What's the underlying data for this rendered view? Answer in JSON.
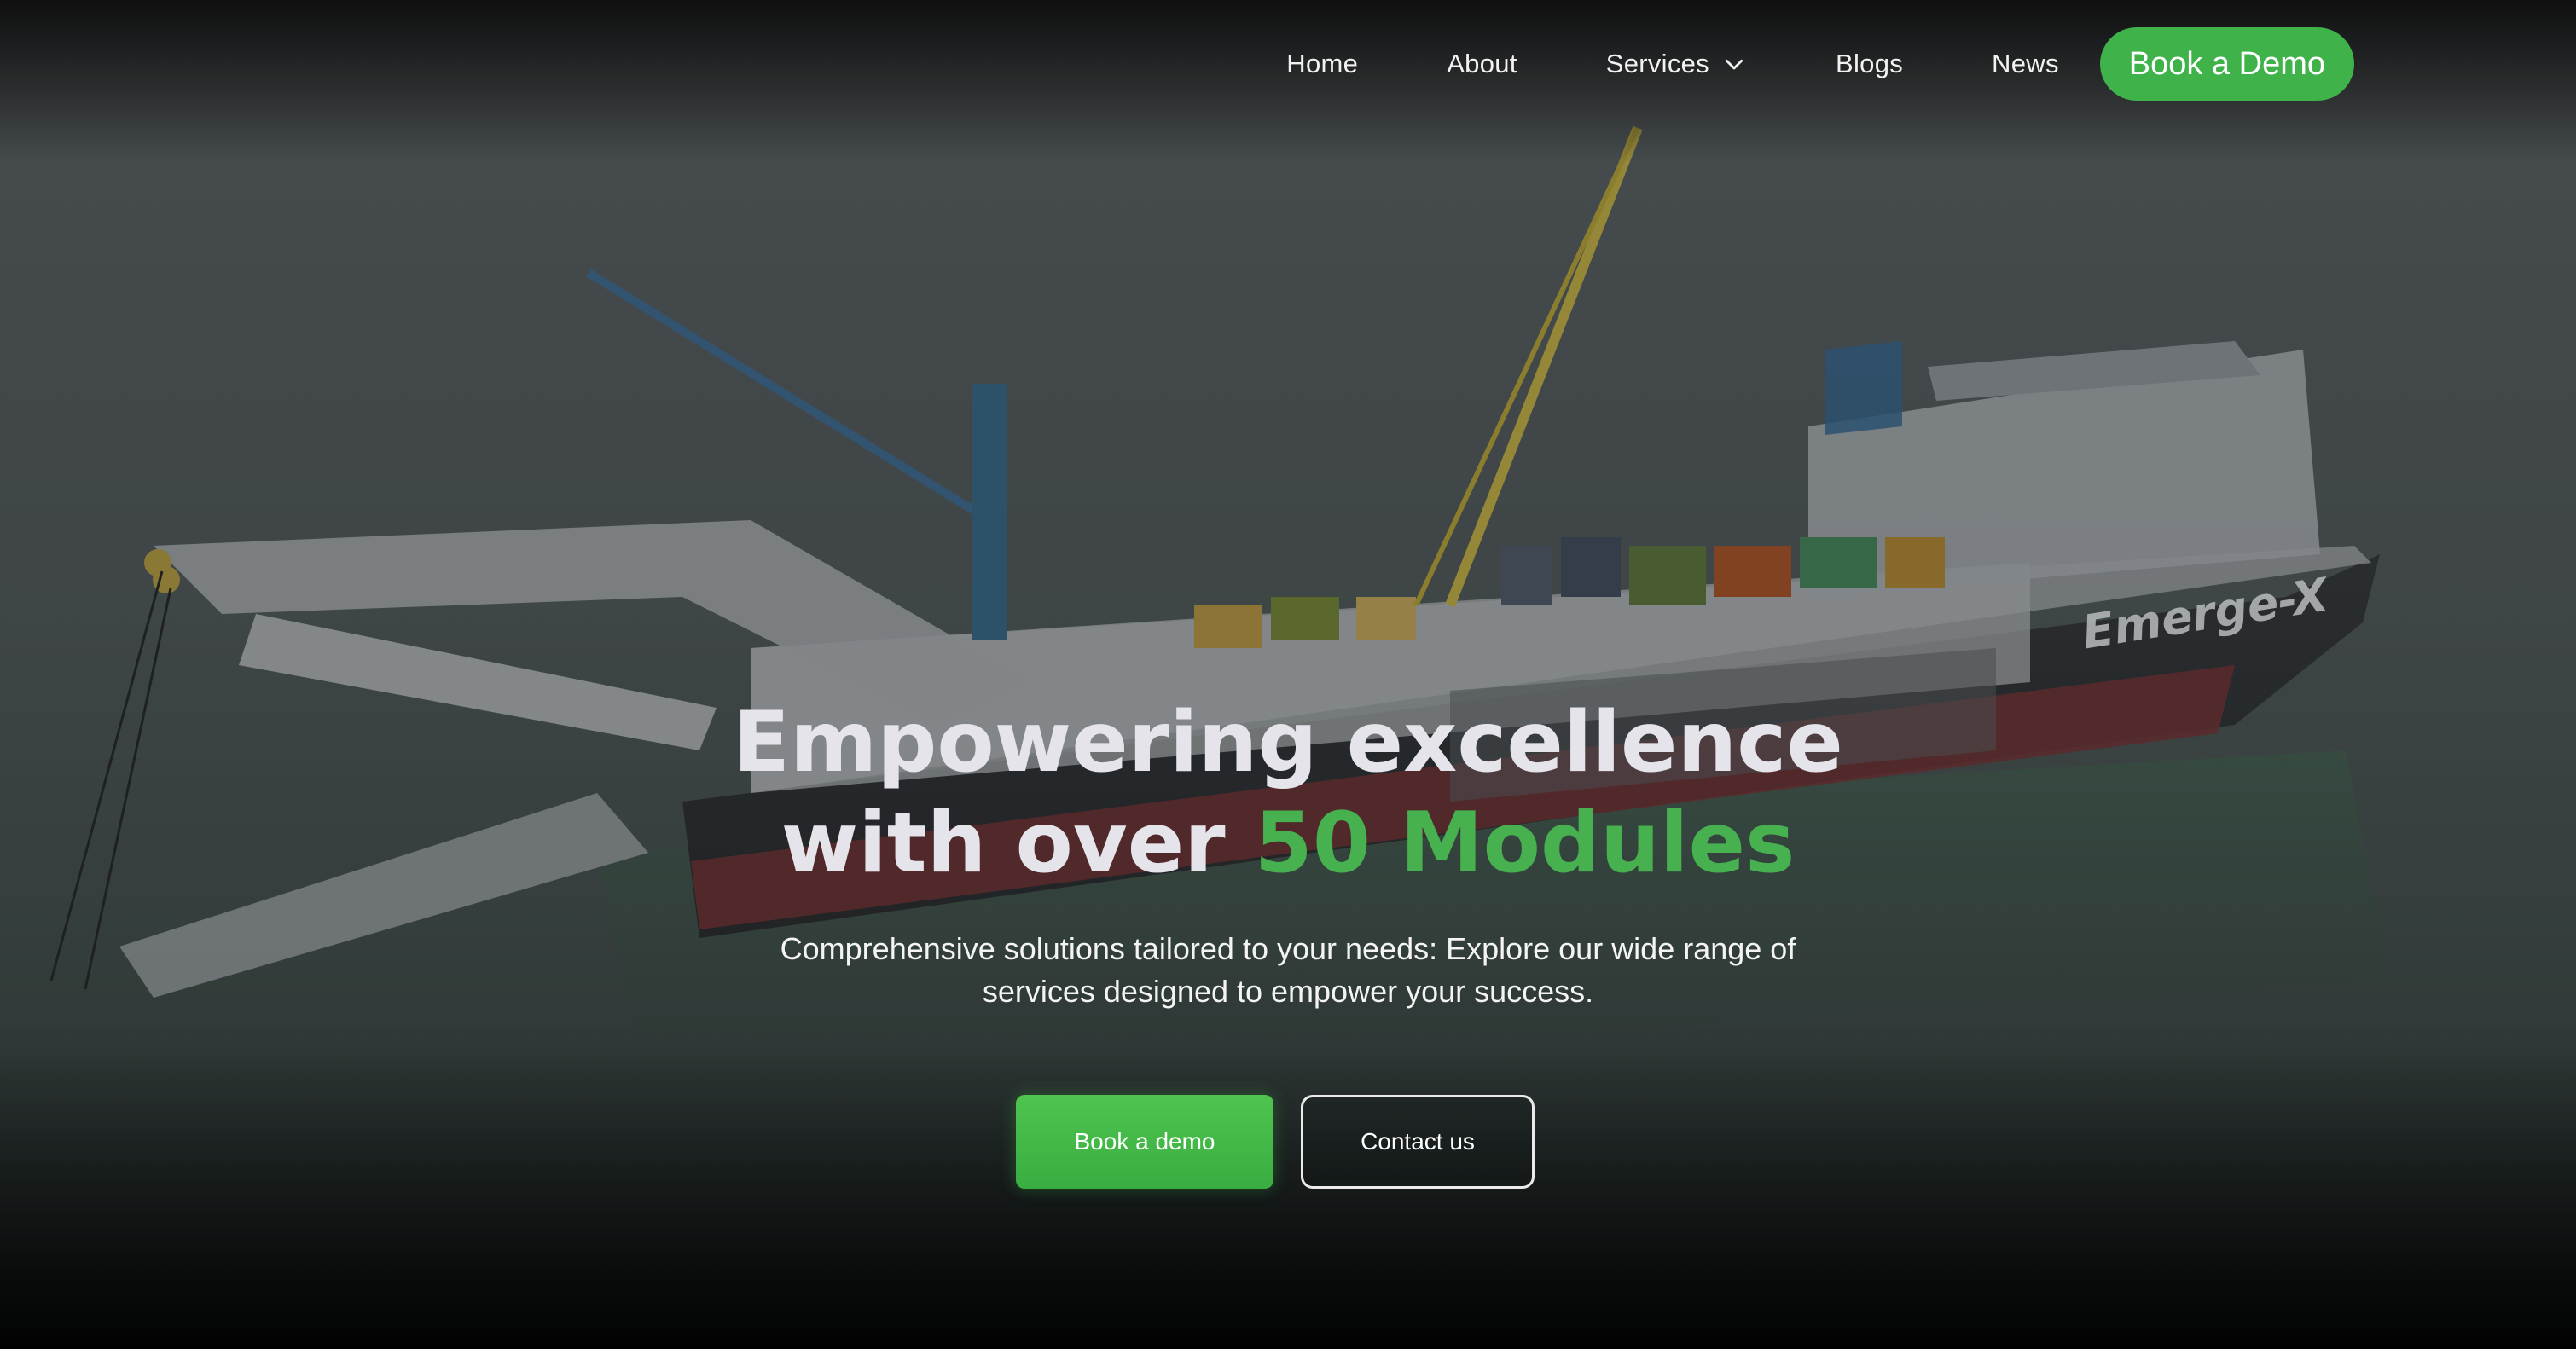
{
  "nav": {
    "items": [
      {
        "label": "Home"
      },
      {
        "label": "About"
      },
      {
        "label": "Services",
        "has_dropdown": true,
        "icon": "chevron-down-icon"
      },
      {
        "label": "Blogs"
      },
      {
        "label": "News"
      }
    ],
    "cta_label": "Book a Demo"
  },
  "hero": {
    "headline_line1": "Empowering excellence",
    "headline_line2_prefix": "with over ",
    "headline_line2_accent": "50 Modules",
    "subtitle_line1": "Comprehensive solutions tailored to your needs: Explore our wide range of",
    "subtitle_line2": "services designed to empower your success.",
    "primary_button": "Book a demo",
    "secondary_button": "Contact us",
    "ship_brand": "Emerge-X"
  },
  "colors": {
    "accent": "#47b04f",
    "cta": "#3fb24a",
    "headline": "#e4e4ea"
  }
}
